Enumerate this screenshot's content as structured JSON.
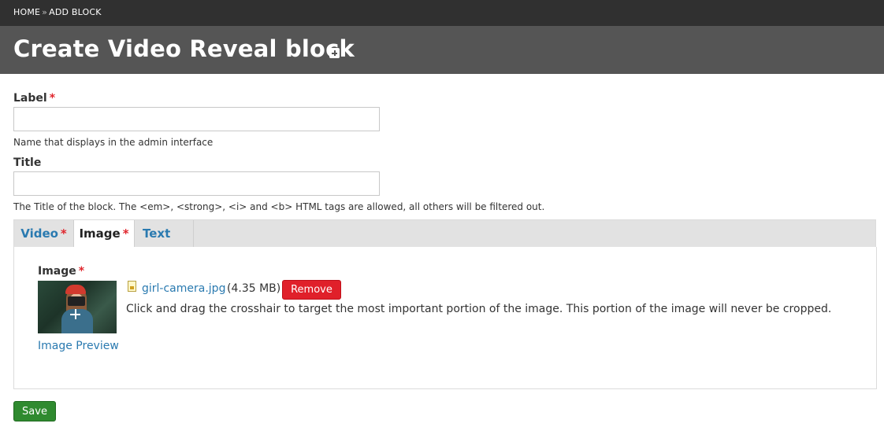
{
  "breadcrumb": {
    "home": "HOME",
    "separator": "»",
    "current": "ADD BLOCK"
  },
  "page": {
    "title": "Create Video Reveal block",
    "shortcut_icon": "plus-square-icon"
  },
  "required_marker": "*",
  "label_field": {
    "label": "Label",
    "value": "",
    "description": "Name that displays in the admin interface"
  },
  "title_field": {
    "label": "Title",
    "value": "",
    "description": "The Title of the block. The <em>, <strong>, <i> and <b> HTML tags are allowed, all others will be filtered out."
  },
  "tabs": [
    {
      "label": "Video",
      "required": true,
      "active": false
    },
    {
      "label": "Image",
      "required": true,
      "active": true
    },
    {
      "label": "Text",
      "required": false,
      "active": false
    }
  ],
  "image_field": {
    "label": "Image",
    "file_name": "girl-camera.jpg",
    "file_size": "(4.35 MB)",
    "remove_label": "Remove",
    "help_text": "Click and drag the crosshair to target the most important portion of the image. This portion of the image will never be cropped.",
    "preview_link": "Image Preview",
    "file_icon": "image-file-icon",
    "crosshair_icon": "crosshair-icon"
  },
  "actions": {
    "save_label": "Save"
  },
  "colors": {
    "topbar": "#303030",
    "header": "#555555",
    "link": "#2a7ab0",
    "required": "#e0262d",
    "remove_button": "#e0202a",
    "save_button": "#2f8a2f"
  }
}
